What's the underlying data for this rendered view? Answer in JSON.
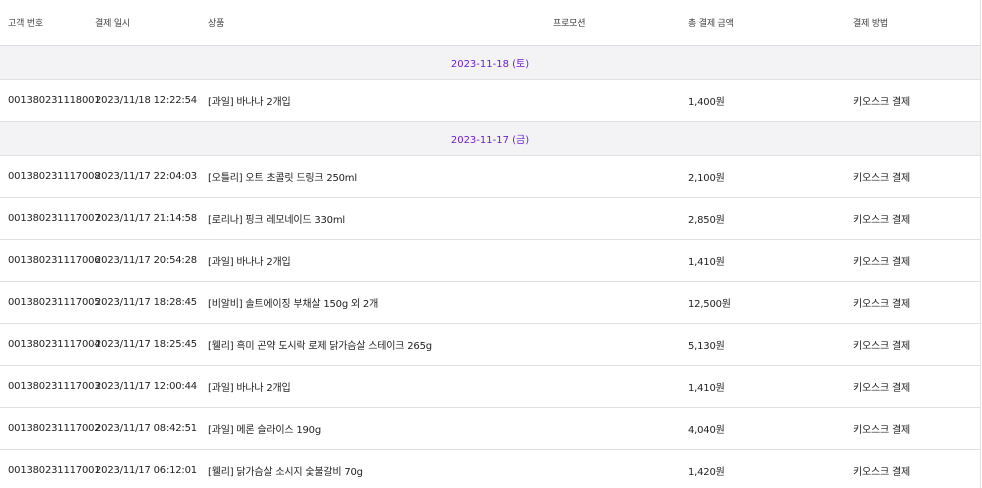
{
  "columns": {
    "customer_no": "고객 번호",
    "paid_at": "결제 일시",
    "product": "상품",
    "promotion": "프로모션",
    "total_amount": "총 결제 금액",
    "payment_method": "결제 방법"
  },
  "groups": [
    {
      "date_label": "2023-11-18 (토)",
      "rows": [
        {
          "customer_no": "001380231118001",
          "paid_at": "2023/11/18 12:22:54",
          "product": "[과일] 바나나 2개입",
          "promotion": "",
          "amount": "1,400원",
          "method": "키오스크 결제"
        }
      ]
    },
    {
      "date_label": "2023-11-17 (금)",
      "rows": [
        {
          "customer_no": "001380231117008",
          "paid_at": "2023/11/17 22:04:03",
          "product": "[오틀리] 오트 초콜릿 드링크 250ml",
          "promotion": "",
          "amount": "2,100원",
          "method": "키오스크 결제"
        },
        {
          "customer_no": "001380231117007",
          "paid_at": "2023/11/17 21:14:58",
          "product": "[로리나] 핑크 레모네이드 330ml",
          "promotion": "",
          "amount": "2,850원",
          "method": "키오스크 결제"
        },
        {
          "customer_no": "001380231117006",
          "paid_at": "2023/11/17 20:54:28",
          "product": "[과일] 바나나 2개입",
          "promotion": "",
          "amount": "1,410원",
          "method": "키오스크 결제"
        },
        {
          "customer_no": "001380231117005",
          "paid_at": "2023/11/17 18:28:45",
          "product": "[비알비] 솔트에이징 부채살 150g 외 2개",
          "promotion": "",
          "amount": "12,500원",
          "method": "키오스크 결제"
        },
        {
          "customer_no": "001380231117004",
          "paid_at": "2023/11/17 18:25:45",
          "product": "[웰리] 흑미 곤약 도시락 로제 닭가슴살 스테이크 265g",
          "promotion": "",
          "amount": "5,130원",
          "method": "키오스크 결제"
        },
        {
          "customer_no": "001380231117003",
          "paid_at": "2023/11/17 12:00:44",
          "product": "[과일] 바나나 2개입",
          "promotion": "",
          "amount": "1,410원",
          "method": "키오스크 결제"
        },
        {
          "customer_no": "001380231117002",
          "paid_at": "2023/11/17 08:42:51",
          "product": "[과일] 메론 슬라이스 190g",
          "promotion": "",
          "amount": "4,040원",
          "method": "키오스크 결제"
        },
        {
          "customer_no": "001380231117001",
          "paid_at": "2023/11/17 06:12:01",
          "product": "[웰리] 닭가슴살 소시지 숯불갈비 70g",
          "promotion": "",
          "amount": "1,420원",
          "method": "키오스크 결제"
        }
      ]
    }
  ],
  "colors": {
    "group_label": "#6a1fd1",
    "group_background": "#f3f3f6",
    "divider": "#e0e0e3"
  }
}
